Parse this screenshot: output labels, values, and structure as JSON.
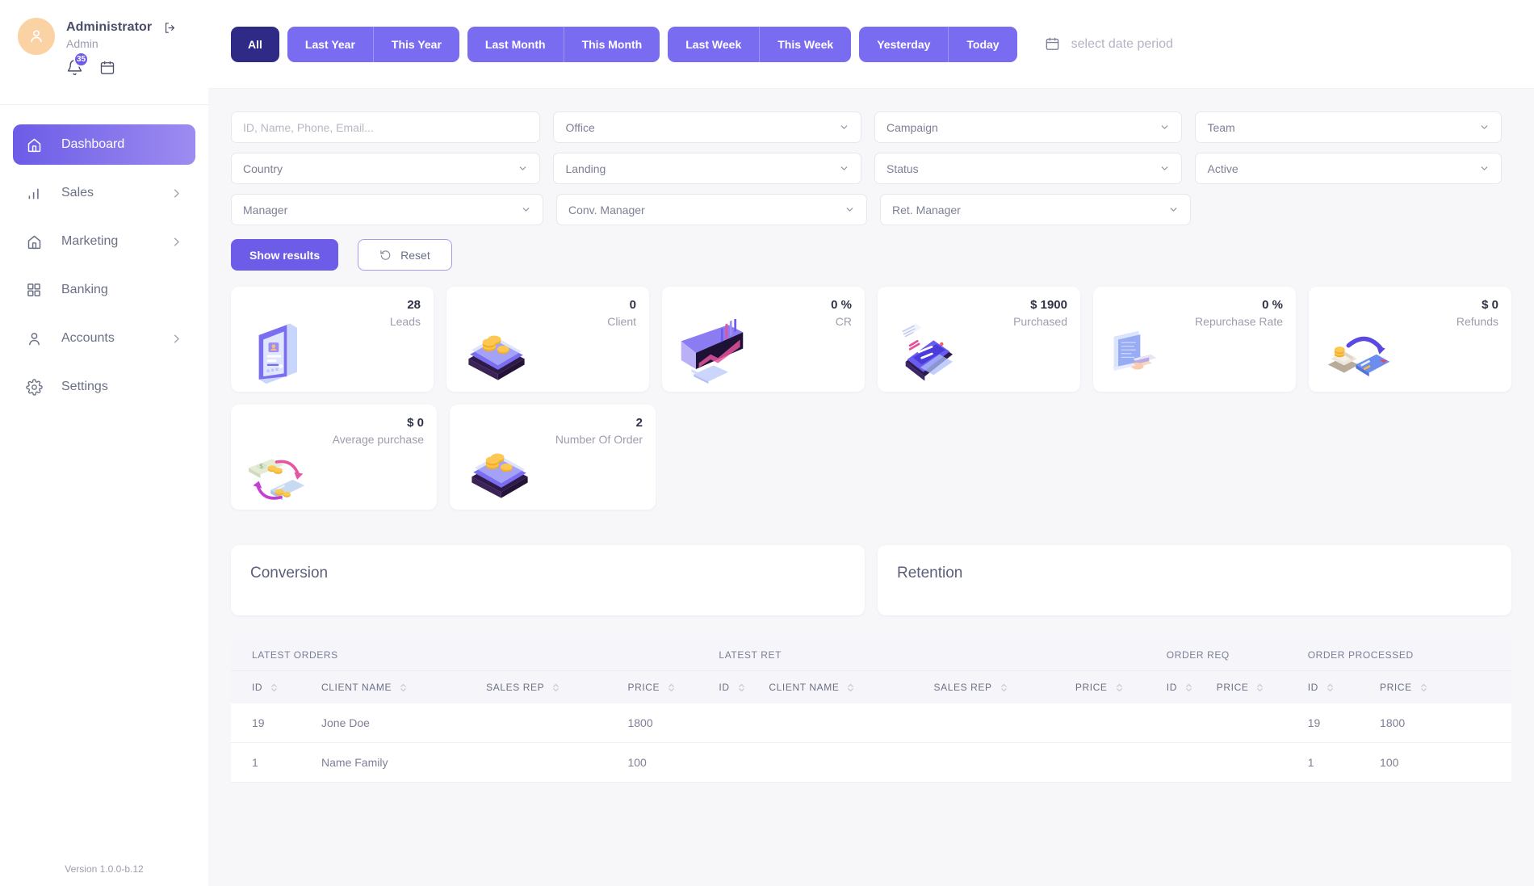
{
  "sidebar": {
    "profile": {
      "name": "Administrator",
      "role": "Admin",
      "notification_count": "35",
      "logout_icon": "logout-icon",
      "bell_icon": "bell-icon",
      "calendar_icon": "calendar-icon",
      "avatar_icon": "user-avatar-icon"
    },
    "items": [
      {
        "label": "Dashboard",
        "icon": "home-icon",
        "active": true,
        "chevron": false
      },
      {
        "label": "Sales",
        "icon": "bar-chart-icon",
        "active": false,
        "chevron": true
      },
      {
        "label": "Marketing",
        "icon": "home-icon",
        "active": false,
        "chevron": true
      },
      {
        "label": "Banking",
        "icon": "grid-icon",
        "active": false,
        "chevron": false
      },
      {
        "label": "Accounts",
        "icon": "person-icon",
        "active": false,
        "chevron": true
      },
      {
        "label": "Settings",
        "icon": "gear-icon",
        "active": false,
        "chevron": false
      }
    ],
    "version": "Version 1.0.0-b.12"
  },
  "topbar": {
    "groups": [
      {
        "buttons": [
          "All"
        ],
        "selected": true
      },
      {
        "buttons": [
          "Last Year",
          "This Year"
        ],
        "selected": false
      },
      {
        "buttons": [
          "Last Month",
          "This Month"
        ],
        "selected": false
      },
      {
        "buttons": [
          "Last Week",
          "This Week"
        ],
        "selected": false
      },
      {
        "buttons": [
          "Yesterday",
          "Today"
        ],
        "selected": false
      }
    ],
    "date_picker": {
      "icon": "calendar-icon",
      "placeholder": "select date period"
    }
  },
  "filters": {
    "row1": [
      {
        "name": "search",
        "value": "",
        "placeholder": "ID, Name, Phone, Email...",
        "type": "input"
      },
      {
        "name": "office",
        "value": "Office",
        "type": "select"
      },
      {
        "name": "campaign",
        "value": "Campaign",
        "type": "select"
      },
      {
        "name": "team",
        "value": "Team",
        "type": "select"
      }
    ],
    "row2": [
      {
        "name": "country",
        "value": "Country",
        "type": "select"
      },
      {
        "name": "landing",
        "value": "Landing",
        "type": "select"
      },
      {
        "name": "status",
        "value": "Status",
        "type": "select"
      },
      {
        "name": "active",
        "value": "Active",
        "type": "select"
      }
    ],
    "row3": [
      {
        "name": "manager",
        "value": "Manager",
        "type": "select"
      },
      {
        "name": "conv-manager",
        "value": "Conv. Manager",
        "type": "select"
      },
      {
        "name": "ret-manager",
        "value": "Ret. Manager",
        "type": "select"
      }
    ],
    "show_results_label": "Show results",
    "reset_label": "Reset",
    "reset_icon": "undo-icon"
  },
  "stats": {
    "row1": [
      {
        "value": "28",
        "label": "Leads",
        "art": "leads-illustration"
      },
      {
        "value": "0",
        "label": "Client",
        "art": "coins-card-illustration"
      },
      {
        "value": "0 %",
        "label": "CR",
        "art": "monitor-chart-illustration"
      },
      {
        "value": "$ 1900",
        "label": "Purchased",
        "art": "phone-payment-illustration"
      },
      {
        "value": "0 %",
        "label": "Repurchase Rate",
        "art": "hand-cash-illustration"
      },
      {
        "value": "$ 0",
        "label": "Refunds",
        "art": "refund-card-illustration"
      }
    ],
    "row2": [
      {
        "value": "$ 0",
        "label": "Average purchase",
        "art": "exchange-money-illustration"
      },
      {
        "value": "2",
        "label": "Number Of Order",
        "art": "coins-card-illustration"
      }
    ]
  },
  "panels": [
    {
      "title": "Conversion"
    },
    {
      "title": "Retention"
    }
  ],
  "table": {
    "groups": [
      {
        "label": "LATEST ORDERS",
        "span": 4
      },
      {
        "label": "LATEST RET",
        "span": 4
      },
      {
        "label": "ORDER REQ",
        "span": 2
      },
      {
        "label": "ORDER PROCESSED",
        "span": 2
      }
    ],
    "columns": [
      "ID",
      "CLIENT NAME",
      "SALES REP",
      "PRICE",
      "ID",
      "CLIENT NAME",
      "SALES REP",
      "PRICE",
      "ID",
      "PRICE",
      "ID",
      "PRICE"
    ],
    "rows": [
      [
        "19",
        "Jone Doe",
        "",
        "1800",
        "",
        "",
        "",
        "",
        "",
        "",
        "19",
        "1800"
      ],
      [
        "1",
        "Name Family",
        "",
        "100",
        "",
        "",
        "",
        "",
        "",
        "",
        "1",
        "100"
      ]
    ]
  },
  "colors": {
    "accent": "#6c5ce7",
    "accent_light": "#7a6cf0",
    "accent_dark": "#2f2a85",
    "background": "#f7f7fa",
    "surface": "#ffffff",
    "text_muted": "#9b9ead",
    "avatar_bg": "#fbd2a4"
  }
}
